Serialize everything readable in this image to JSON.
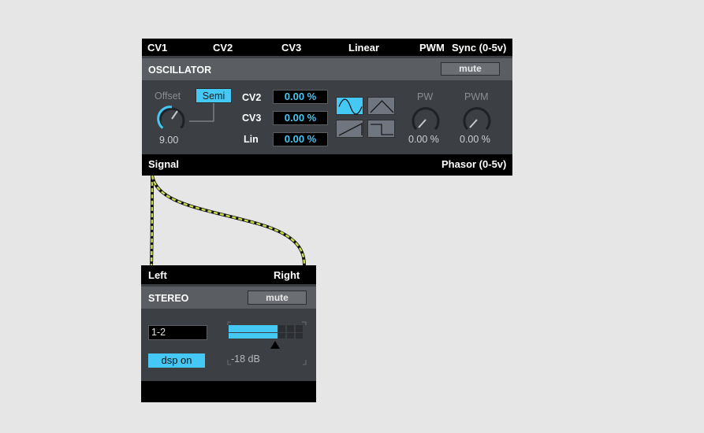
{
  "oscillator": {
    "inputs": [
      "CV1",
      "CV2",
      "CV3",
      "Linear",
      "PWM",
      "Sync (0-5v)"
    ],
    "title": "OSCILLATOR",
    "mute_label": "mute",
    "offset_label": "Offset",
    "semi_label": "Semi",
    "offset_value": "9.00",
    "cv_rows": [
      {
        "label": "CV2",
        "value": "0.00 %"
      },
      {
        "label": "CV3",
        "value": "0.00 %"
      },
      {
        "label": "Lin",
        "value": "0.00 %"
      }
    ],
    "waveforms": [
      "sine",
      "triangle",
      "saw",
      "square"
    ],
    "selected_waveform": "sine",
    "pw_label": "PW",
    "pw_value": "0.00 %",
    "pwm_label": "PWM",
    "pwm_value": "0.00 %",
    "outputs": [
      "Signal",
      "Phasor (0-5v)"
    ]
  },
  "stereo": {
    "inputs": [
      "Left",
      "Right"
    ],
    "title": "STEREO",
    "mute_label": "mute",
    "channel_select": "1-2",
    "dsp_label": "dsp on",
    "gain_label": "-18 dB"
  },
  "colors": {
    "accent": "#44c8f5",
    "panel": "#3c3f44",
    "titlebar": "#5a5d62",
    "port_bar": "#000000",
    "cable": "#c8d84a"
  }
}
